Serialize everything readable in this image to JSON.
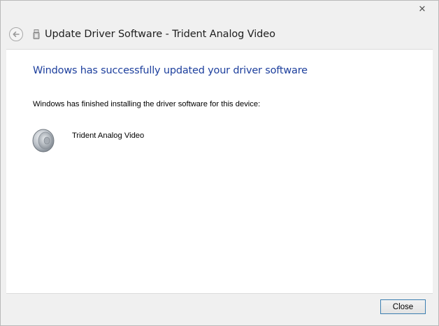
{
  "window": {
    "close_glyph": "✕"
  },
  "header": {
    "title": "Update Driver Software - Trident Analog Video",
    "back_icon": "back-arrow-icon",
    "device_icon": "usb-device-icon"
  },
  "content": {
    "heading": "Windows has successfully updated your driver software",
    "message": "Windows has finished installing the driver software for this device:",
    "device_name": "Trident Analog Video",
    "device_icon": "speaker-icon"
  },
  "footer": {
    "close_label": "Close"
  },
  "colors": {
    "heading": "#1d3f9d",
    "content_bg": "#ffffff",
    "chrome_bg": "#f0f0f0",
    "button_border": "#3c7fb1"
  }
}
